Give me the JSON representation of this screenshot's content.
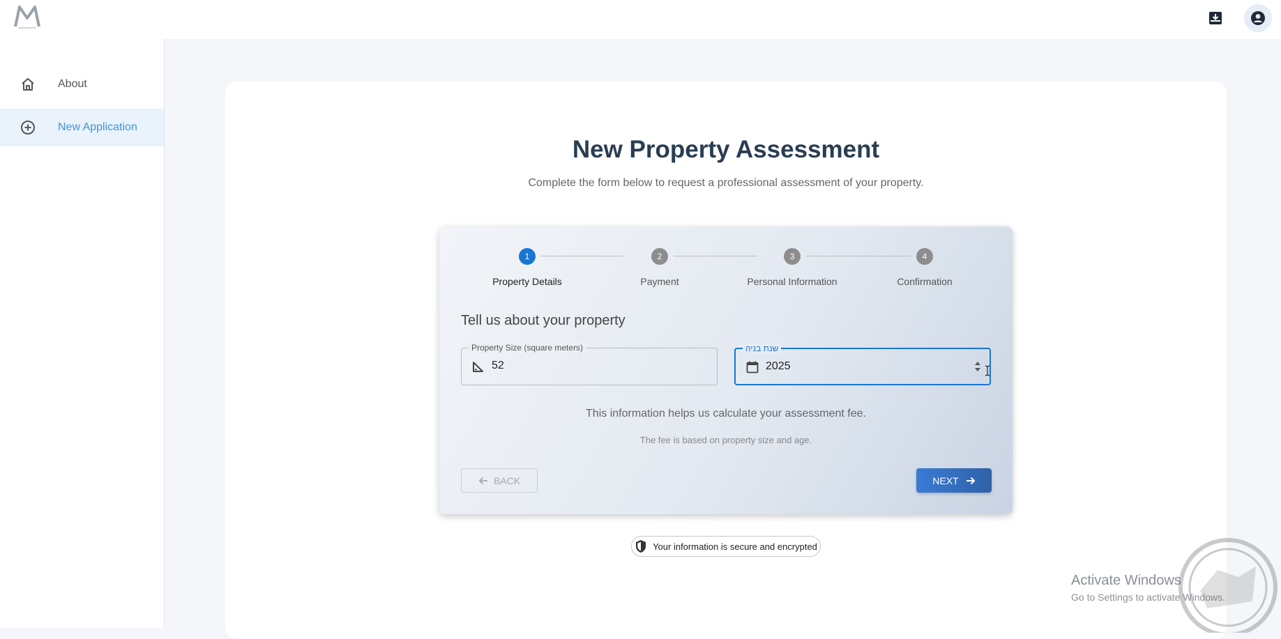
{
  "header": {
    "logo_text": "M",
    "download_icon": "download-box-icon",
    "account_icon": "account-circle-icon"
  },
  "sidebar": {
    "items": [
      {
        "label": "About",
        "icon": "home-icon"
      },
      {
        "label": "New Application",
        "icon": "add-circle-icon",
        "active": true
      }
    ]
  },
  "main": {
    "title": "New Property Assessment",
    "subtitle": "Complete the form below to request a professional assessment of your property."
  },
  "stepper": {
    "steps": [
      {
        "number": "1",
        "label": "Property Details",
        "active": true
      },
      {
        "number": "2",
        "label": "Payment"
      },
      {
        "number": "3",
        "label": "Personal Information"
      },
      {
        "number": "4",
        "label": "Confirmation"
      }
    ]
  },
  "form": {
    "heading": "Tell us about your property",
    "size_field": {
      "label": "Property Size (square meters)",
      "value": "52"
    },
    "year_field": {
      "label": "שנת בניה",
      "value": "2025"
    },
    "info_primary": "This information helps us calculate your assessment fee.",
    "info_secondary": "The fee is based on property size and age.",
    "back_label": "BACK",
    "next_label": "NEXT"
  },
  "footer": {
    "secure_text": "Your information is secure and encrypted"
  },
  "watermark": {
    "line1": "Activate Windows",
    "line2": "Go to Settings to activate Windows."
  },
  "colors": {
    "accent": "#1976d2",
    "sidebar_active": "#3e97d8",
    "title": "#2a3d52"
  }
}
